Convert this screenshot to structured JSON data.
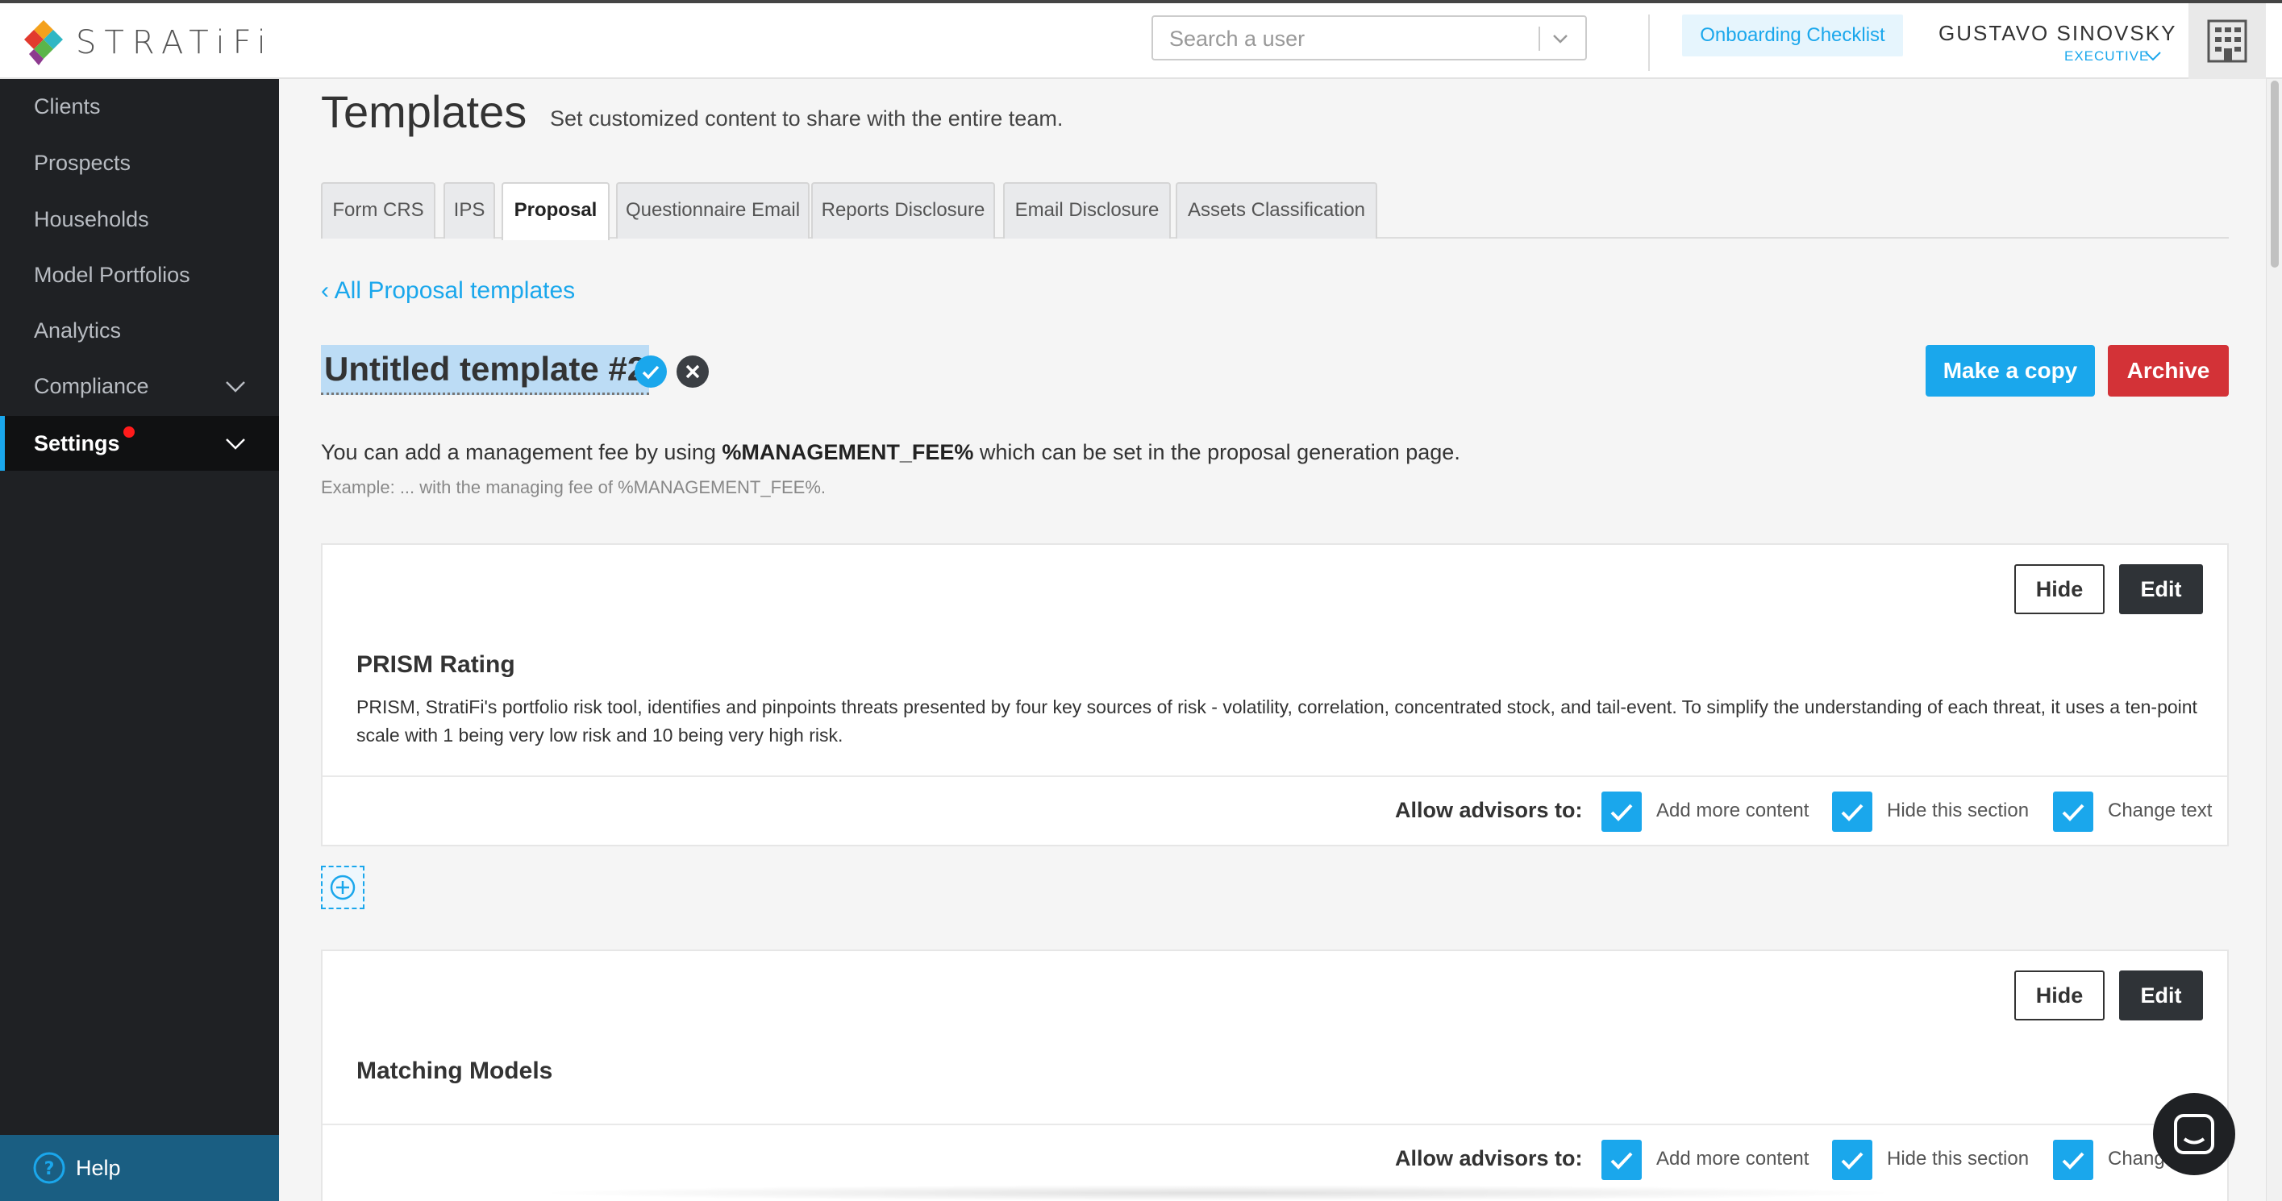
{
  "brand": {
    "name": "STRATiFi"
  },
  "header": {
    "search_placeholder": "Search a user",
    "onboarding_label": "Onboarding Checklist",
    "user_name": "GUSTAVO SINOVSKY",
    "user_role": "EXECUTIVE"
  },
  "sidebar": {
    "items": [
      {
        "label": "Clients"
      },
      {
        "label": "Prospects"
      },
      {
        "label": "Households"
      },
      {
        "label": "Model Portfolios"
      },
      {
        "label": "Analytics"
      },
      {
        "label": "Compliance"
      },
      {
        "label": "Settings"
      }
    ],
    "help_label": "Help"
  },
  "page": {
    "title": "Templates",
    "subtitle": "Set customized content to share with the entire team."
  },
  "tabs": [
    {
      "label": "Form CRS"
    },
    {
      "label": "IPS"
    },
    {
      "label": "Proposal"
    },
    {
      "label": "Questionnaire Email"
    },
    {
      "label": "Reports Disclosure"
    },
    {
      "label": "Email Disclosure"
    },
    {
      "label": "Assets Classification"
    }
  ],
  "back_link": "‹ All Proposal templates",
  "template": {
    "name": "Untitled template #2",
    "copy_label": "Make a copy",
    "archive_label": "Archive"
  },
  "info": {
    "before": "You can add a management fee by using ",
    "token": "%MANAGEMENT_FEE%",
    "after": " which can be set in the proposal generation page.",
    "example": "Example: ... with the managing fee of %MANAGEMENT_FEE%."
  },
  "sections": [
    {
      "title": "PRISM Rating",
      "body": "PRISM, StratiFi's portfolio risk tool, identifies and pinpoints threats presented by four key sources of risk - volatility, correlation, concentrated stock, and tail-event. To simplify the understanding of each threat, it uses a ten-point scale with 1 being very low risk and 10 being very high risk.",
      "hide_label": "Hide",
      "edit_label": "Edit",
      "allow_label": "Allow advisors to:",
      "options": [
        "Add more content",
        "Hide this section",
        "Change text"
      ]
    },
    {
      "title": "Matching Models",
      "hide_label": "Hide",
      "edit_label": "Edit",
      "allow_label": "Allow advisors to:",
      "options": [
        "Add more content",
        "Hide this section",
        "Change text"
      ]
    }
  ],
  "colors": {
    "accent": "#1aa7ec",
    "danger": "#d33237",
    "sidebar": "#1f2124",
    "dark_button": "#2f3337"
  }
}
